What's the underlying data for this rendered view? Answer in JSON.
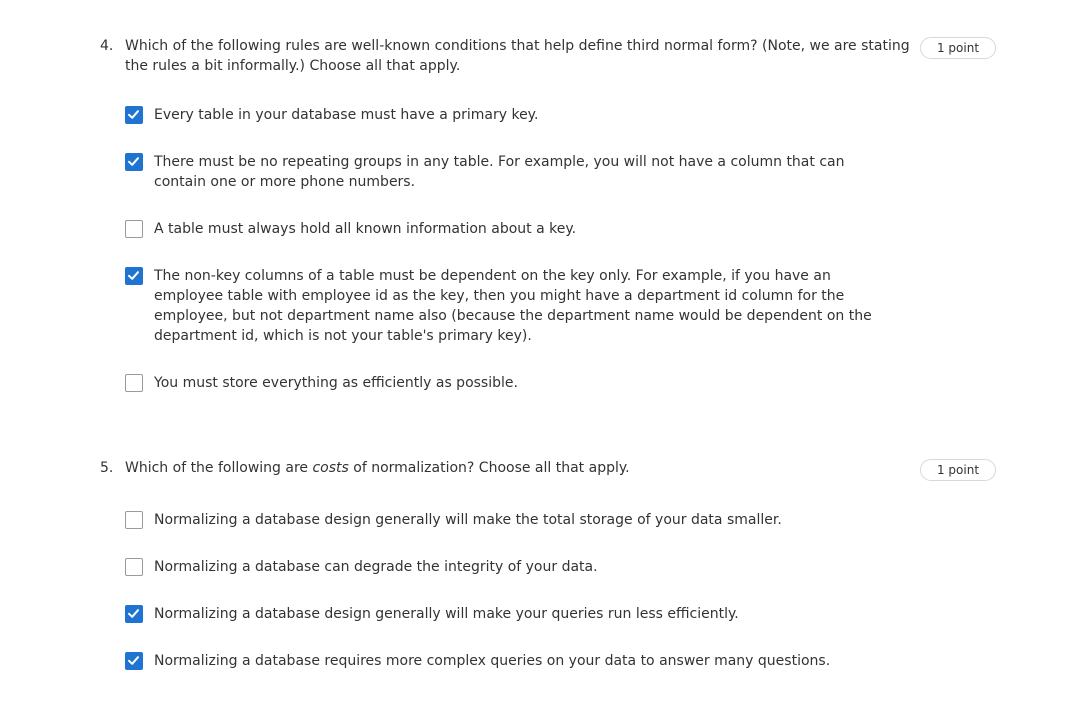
{
  "questions": [
    {
      "number": "4.",
      "text": "Which of the following rules are well-known conditions that help define third normal form? (Note, we are stating the rules a bit informally.) Choose all that apply.",
      "points": "1 point",
      "options": [
        {
          "label": "Every table in your database must have a primary key.",
          "checked": true
        },
        {
          "label": "There must be no repeating groups in any table. For example, you will not have a column that can contain one or more phone numbers.",
          "checked": true
        },
        {
          "label": "A table must always hold all known information about a key.",
          "checked": false
        },
        {
          "label": "The non-key columns of a table must be dependent on the key only. For example, if you have an employee table with employee id as the key, then you might have a department id column for the employee, but not department name also (because the department name would be dependent on the department id, which is not your table's primary key).",
          "checked": true
        },
        {
          "label": "You must store everything as efficiently as possible.",
          "checked": false
        }
      ]
    },
    {
      "number": "5.",
      "text_before": "Which of the following are ",
      "text_emphasis": "costs",
      "text_after": " of normalization? Choose all that apply.",
      "points": "1 point",
      "options": [
        {
          "label": "Normalizing a database design generally will make the total storage of your data smaller.",
          "checked": false
        },
        {
          "label": "Normalizing a database can degrade the integrity of your data.",
          "checked": false
        },
        {
          "label": "Normalizing a database design generally will make your queries run less efficiently.",
          "checked": true
        },
        {
          "label": "Normalizing a database requires more complex queries on your data to answer many questions.",
          "checked": true
        }
      ]
    }
  ],
  "colors": {
    "checkbox_checked": "#1f73d1",
    "checkbox_unchecked_border": "#9a9a9a",
    "text": "#333333",
    "badge_border": "#d8d8d8"
  }
}
